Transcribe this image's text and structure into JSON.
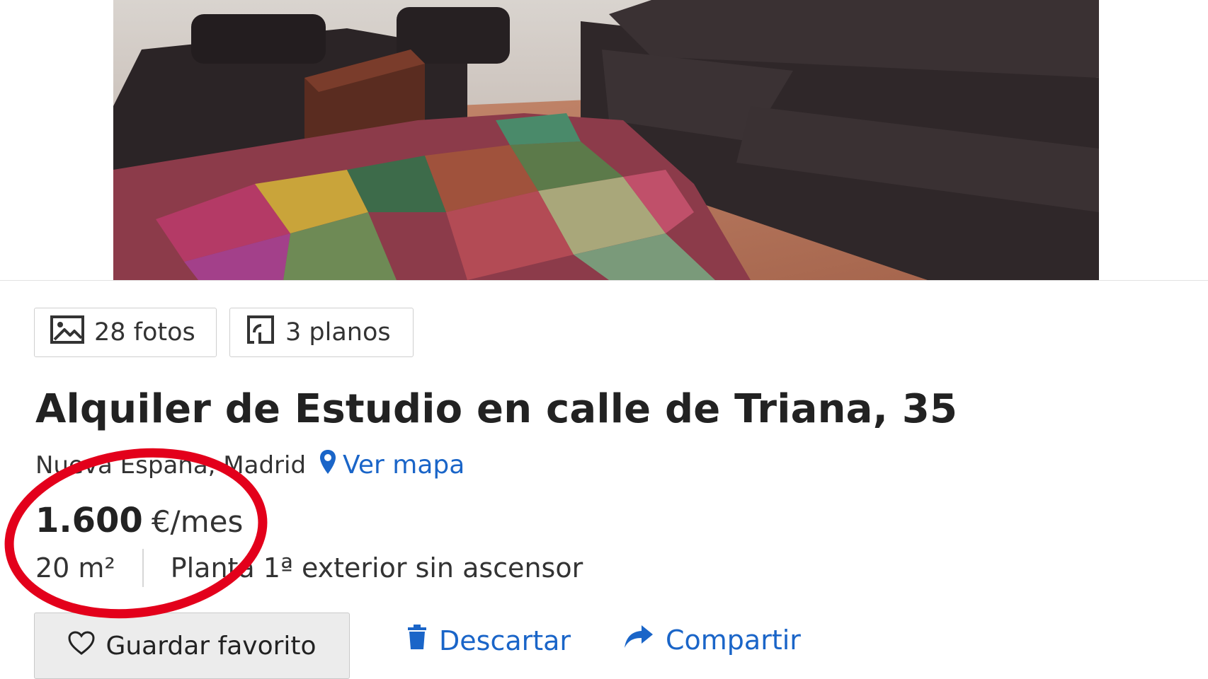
{
  "gallery": {
    "photo": "living-room-photo",
    "photos_label": "28 fotos",
    "plans_label": "3 planos"
  },
  "listing": {
    "title": "Alquiler de Estudio en calle de Triana, 35",
    "location": "Nueva España, Madrid",
    "map_link": "Ver mapa",
    "price_amount": "1.600",
    "price_unit": "€/mes",
    "area": "20 m²",
    "floor_info": "Planta 1ª exterior sin ascensor"
  },
  "actions": {
    "favorite_label": "Guardar favorito",
    "discard_label": "Descartar",
    "share_label": "Compartir"
  },
  "colors": {
    "link_blue": "#1a65c8",
    "annotation_red": "#e3001b",
    "text_dark": "#222222"
  },
  "icons": {
    "photos": "image-icon",
    "plans": "floorplan-icon",
    "map": "map-pin-icon",
    "favorite": "heart-outline-icon",
    "discard": "trash-icon",
    "share": "share-arrow-icon"
  }
}
